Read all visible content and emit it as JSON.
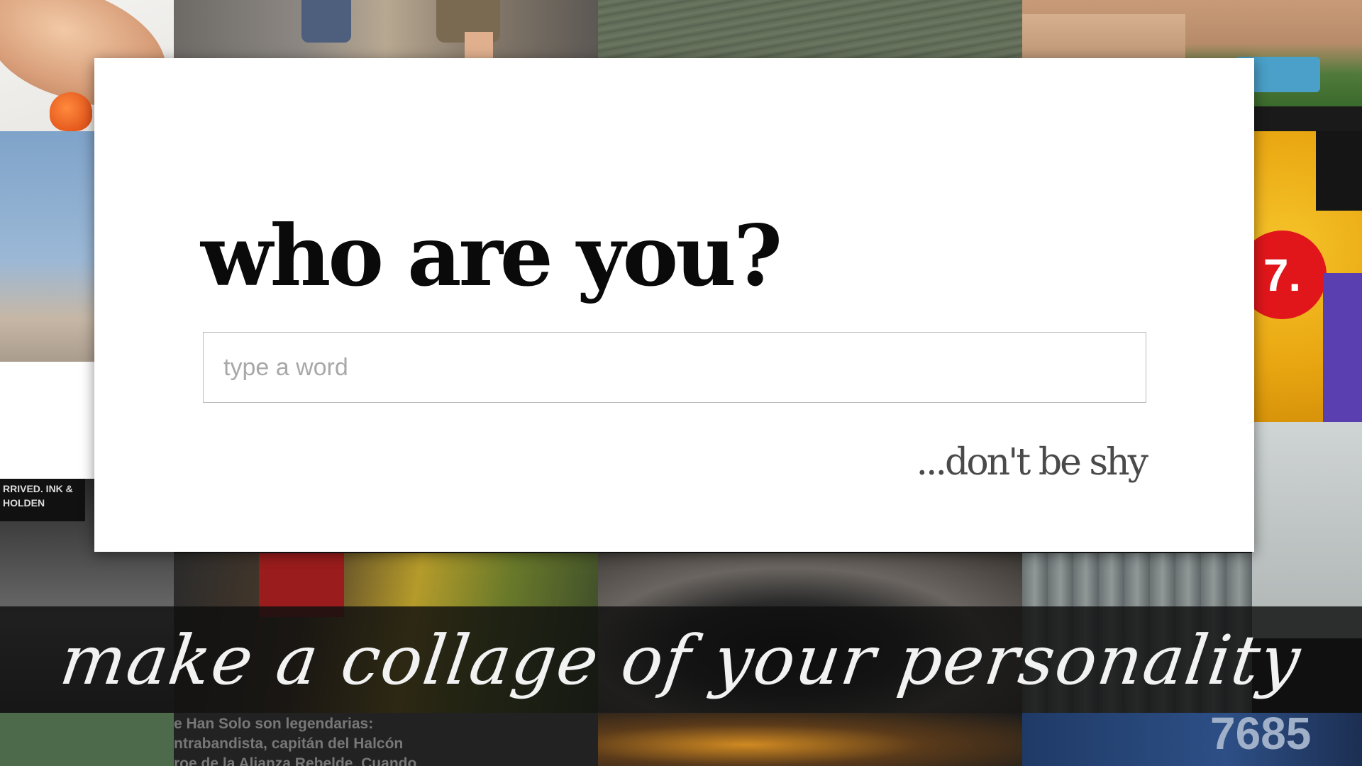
{
  "modal": {
    "title": "who are you?",
    "input": {
      "value": "",
      "placeholder": "type a word"
    },
    "hint": "...don't be shy"
  },
  "banner": {
    "tagline": "make a collage of your personality"
  },
  "collage": {
    "tiles": [
      {
        "name": "hand-with-flower"
      },
      {
        "name": "legs-on-street"
      },
      {
        "name": "water-surface"
      },
      {
        "name": "palace-garden"
      },
      {
        "name": "blue-sky"
      },
      {
        "name": "white-card"
      },
      {
        "name": "yellow-poster",
        "badge_text": "7."
      },
      {
        "name": "foggy-scene"
      },
      {
        "name": "city-street",
        "sign_text": "RRIVED. INK & HOLDEN"
      },
      {
        "name": "soldier-scene"
      },
      {
        "name": "dark-tunnel"
      },
      {
        "name": "curtain"
      },
      {
        "name": "green-tile"
      },
      {
        "name": "text-snippet",
        "lines": [
          "e Han Solo son legendarias:",
          "ntrabandista, capitán del Halcón",
          "roe de la Alianza Rebelde. Cuando"
        ]
      },
      {
        "name": "fire-scene"
      },
      {
        "name": "blue-number",
        "number_text": "7685"
      }
    ]
  }
}
